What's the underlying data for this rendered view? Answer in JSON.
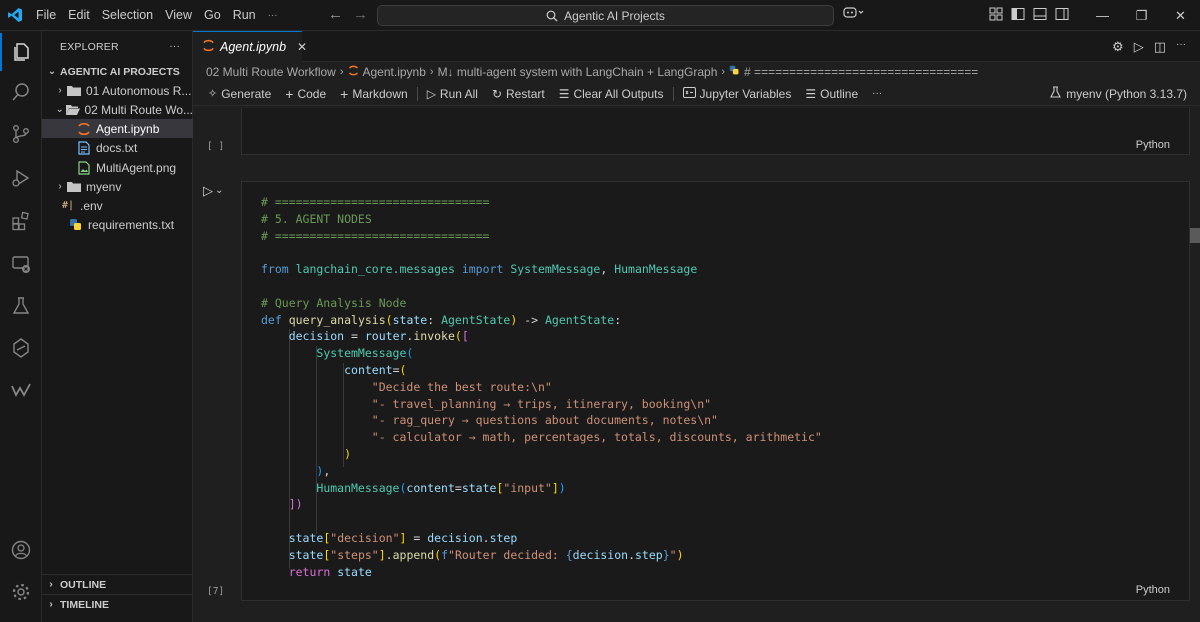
{
  "titlebar": {
    "menu": [
      "File",
      "Edit",
      "Selection",
      "View",
      "Go",
      "Run",
      "···"
    ],
    "search_text": "Agentic AI Projects"
  },
  "explorer": {
    "header": "EXPLORER",
    "root": "AGENTIC AI PROJECTS",
    "items": [
      {
        "label": "01 Autonomous R...",
        "type": "folder",
        "expanded": false
      },
      {
        "label": "02 Multi Route Wo...",
        "type": "folder",
        "expanded": true
      },
      {
        "label": "Agent.ipynb",
        "type": "notebook",
        "selected": true
      },
      {
        "label": "docs.txt",
        "type": "text"
      },
      {
        "label": "MultiAgent.png",
        "type": "image"
      },
      {
        "label": "myenv",
        "type": "folder",
        "expanded": false
      },
      {
        "label": ".env",
        "type": "env"
      },
      {
        "label": "requirements.txt",
        "type": "python-req"
      }
    ],
    "sections": [
      "OUTLINE",
      "TIMELINE"
    ]
  },
  "tab": {
    "label": "Agent.ipynb"
  },
  "breadcrumb": [
    "02 Multi Route Workflow",
    "Agent.ipynb",
    "M↓ multi-agent system with LangChain + LangGraph",
    "# ================================"
  ],
  "toolbar": {
    "generate": "Generate",
    "code": "Code",
    "markdown": "Markdown",
    "run_all": "Run All",
    "restart": "Restart",
    "clear_outputs": "Clear All Outputs",
    "variables": "Jupyter Variables",
    "outline": "Outline",
    "more": "···",
    "kernel": "myenv (Python 3.13.7)"
  },
  "cells": [
    {
      "exec_count": "[ ]",
      "language": "Python"
    },
    {
      "exec_count": "[7]",
      "language": "Python"
    }
  ],
  "colors": {
    "accent": "#0078d4",
    "background": "#1f1f1f",
    "sidebar": "#181818"
  }
}
